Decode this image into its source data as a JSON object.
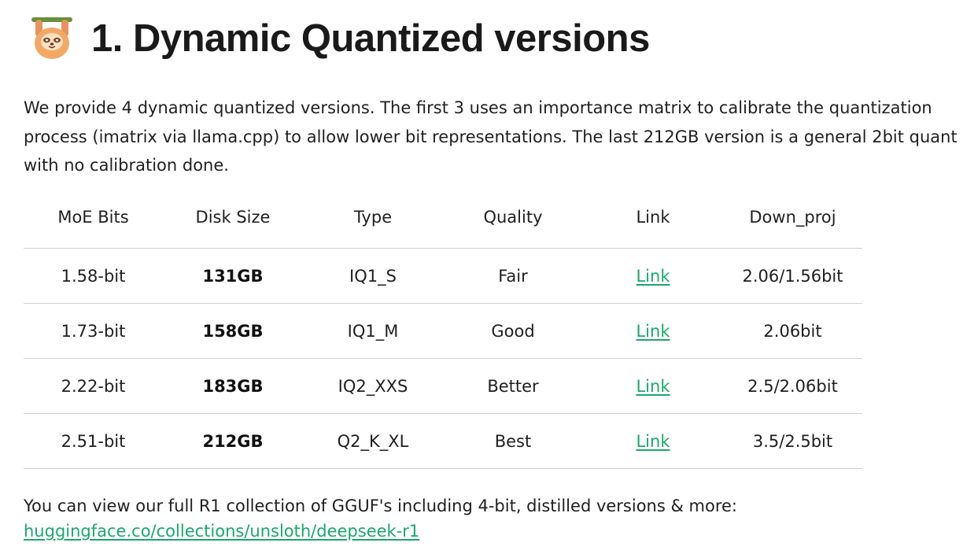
{
  "heading": {
    "logo_icon": "sloth-logo-icon",
    "title": "1. Dynamic Quantized versions"
  },
  "intro": {
    "text": "We provide 4 dynamic quantized versions. The first 3 uses an importance matrix to calibrate the quantization process (imatrix via llama.cpp) to allow lower bit representations. The last 212GB version is a general 2bit quant with no calibration done."
  },
  "table": {
    "headers": [
      "MoE Bits",
      "Disk Size",
      "Type",
      "Quality",
      "Link",
      "Down_proj"
    ],
    "rows": [
      {
        "moe_bits": "1.58-bit",
        "disk_size": "131GB",
        "type": "IQ1_S",
        "quality": "Fair",
        "link": "Link",
        "down_proj": "2.06/1.56bit"
      },
      {
        "moe_bits": "1.73-bit",
        "disk_size": "158GB",
        "type": "IQ1_M",
        "quality": "Good",
        "link": "Link",
        "down_proj": "2.06bit"
      },
      {
        "moe_bits": "2.22-bit",
        "disk_size": "183GB",
        "type": "IQ2_XXS",
        "quality": "Better",
        "link": "Link",
        "down_proj": "2.5/2.06bit"
      },
      {
        "moe_bits": "2.51-bit",
        "disk_size": "212GB",
        "type": "Q2_K_XL",
        "quality": "Best",
        "link": "Link",
        "down_proj": "3.5/2.5bit"
      }
    ]
  },
  "footer": {
    "text": "You can view our full R1 collection of GGUF's including 4-bit, distilled versions & more:",
    "link_text": "huggingface.co/collections/unsloth/deepseek-r1"
  },
  "colors": {
    "link": "#1aa86b",
    "text": "#1f1f1f",
    "divider": "#cfcfcf",
    "logo_body": "#f3a866"
  }
}
